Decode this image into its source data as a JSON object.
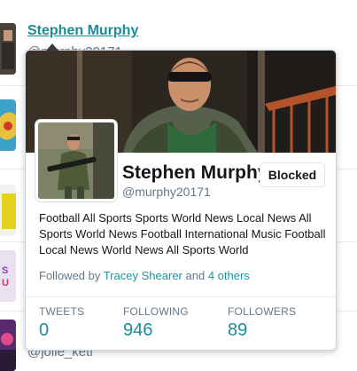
{
  "feed": {
    "items": [
      {
        "name": "Stephen Murphy",
        "handle": "@murphy20171"
      },
      {
        "name": "",
        "handle": "@jolie_ketr"
      }
    ]
  },
  "card": {
    "full_name": "Stephen Murphy",
    "screen_name": "@murphy20171",
    "button_label": "Blocked",
    "bio": "Football All Sports Sports World News Local News All Sports World News Football International Music Football Local News World News All Sports World",
    "followed_by": {
      "prefix": "Followed by",
      "user": "Tracey Shearer",
      "conjunction": "and",
      "others": "4 others"
    },
    "stats": {
      "tweets": {
        "label": "TWEETS",
        "value": "0"
      },
      "following": {
        "label": "FOLLOWING",
        "value": "946"
      },
      "followers": {
        "label": "FOLLOWERS",
        "value": "89"
      }
    }
  },
  "colors": {
    "link": "#1b95a0",
    "stat_value": "#1b8c96",
    "muted": "#657786",
    "border": "#ccd6dd"
  }
}
